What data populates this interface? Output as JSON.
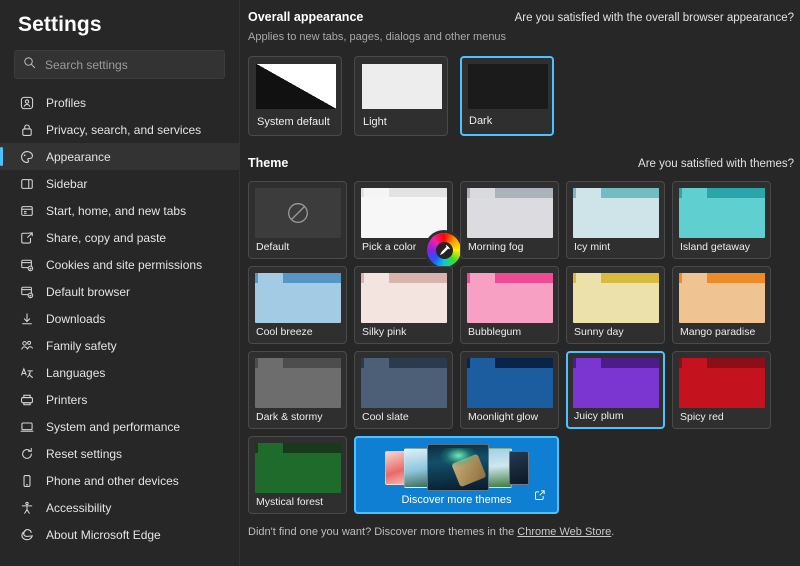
{
  "sidebar": {
    "title": "Settings",
    "search": {
      "placeholder": "Search settings",
      "value": "",
      "icon": "search-icon"
    },
    "items": [
      {
        "label": "Profiles",
        "icon": "profile-icon",
        "selected": false
      },
      {
        "label": "Privacy, search, and services",
        "icon": "lock-icon",
        "selected": false
      },
      {
        "label": "Appearance",
        "icon": "appearance-icon",
        "selected": true
      },
      {
        "label": "Sidebar",
        "icon": "sidebar-icon",
        "selected": false
      },
      {
        "label": "Start, home, and new tabs",
        "icon": "home-tabs-icon",
        "selected": false
      },
      {
        "label": "Share, copy and paste",
        "icon": "share-icon",
        "selected": false
      },
      {
        "label": "Cookies and site permissions",
        "icon": "cookies-icon",
        "selected": false
      },
      {
        "label": "Default browser",
        "icon": "default-browser-icon",
        "selected": false
      },
      {
        "label": "Downloads",
        "icon": "download-icon",
        "selected": false
      },
      {
        "label": "Family safety",
        "icon": "family-icon",
        "selected": false
      },
      {
        "label": "Languages",
        "icon": "languages-icon",
        "selected": false
      },
      {
        "label": "Printers",
        "icon": "printer-icon",
        "selected": false
      },
      {
        "label": "System and performance",
        "icon": "system-icon",
        "selected": false
      },
      {
        "label": "Reset settings",
        "icon": "reset-icon",
        "selected": false
      },
      {
        "label": "Phone and other devices",
        "icon": "phone-icon",
        "selected": false
      },
      {
        "label": "Accessibility",
        "icon": "accessibility-icon",
        "selected": false
      },
      {
        "label": "About Microsoft Edge",
        "icon": "edge-icon",
        "selected": false
      }
    ]
  },
  "overall_appearance": {
    "title": "Overall appearance",
    "feedback_link": "Are you satisfied with the overall browser appearance?",
    "subtitle": "Applies to new tabs, pages, dialogs and other menus",
    "options": [
      {
        "label": "System default",
        "selected": false
      },
      {
        "label": "Light",
        "selected": false
      },
      {
        "label": "Dark",
        "selected": true
      }
    ]
  },
  "theme": {
    "title": "Theme",
    "feedback_link": "Are you satisfied with themes?",
    "selected": "Juicy plum",
    "accent_color": "#4cc2ff",
    "cards": [
      {
        "label": "Default",
        "kind": "default",
        "top": "#3c3c3c",
        "tab": "#3c3c3c",
        "body": "#3c3c3c",
        "selected": false
      },
      {
        "label": "Pick a color",
        "kind": "picker",
        "top": "#e3e3e3",
        "tab": "#f5f5f5",
        "body": "#f7f7f7",
        "selected": false
      },
      {
        "label": "Morning fog",
        "kind": "folder",
        "top": "#adb3bb",
        "tab": "#d9dade",
        "body": "#dcdce0",
        "selected": false
      },
      {
        "label": "Icy mint",
        "kind": "folder",
        "top": "#74bcc4",
        "tab": "#cfe4e8",
        "body": "#cfe4e8",
        "selected": false
      },
      {
        "label": "Island getaway",
        "kind": "folder",
        "top": "#2aa5a9",
        "tab": "#5fd0cf",
        "body": "#5fd0cf",
        "selected": false
      },
      {
        "label": "Cool breeze",
        "kind": "folder",
        "top": "#5596c4",
        "tab": "#a3cbe4",
        "body": "#a3cbe4",
        "selected": false
      },
      {
        "label": "Silky pink",
        "kind": "folder",
        "top": "#d9b4ad",
        "tab": "#f3e4e0",
        "body": "#f3e4e0",
        "selected": false
      },
      {
        "label": "Bubblegum",
        "kind": "folder",
        "top": "#ef4b93",
        "tab": "#f8a0c4",
        "body": "#f8a0c4",
        "selected": false
      },
      {
        "label": "Sunny day",
        "kind": "folder",
        "top": "#d8bb3f",
        "tab": "#ece0ab",
        "body": "#ece0ab",
        "selected": false
      },
      {
        "label": "Mango paradise",
        "kind": "folder",
        "top": "#ef8a28",
        "tab": "#f0c392",
        "body": "#f0c392",
        "selected": false
      },
      {
        "label": "Dark & stormy",
        "kind": "folder",
        "top": "#4d4d4d",
        "tab": "#6d6d6d",
        "body": "#6d6d6d",
        "selected": false
      },
      {
        "label": "Cool slate",
        "kind": "folder",
        "top": "#2c3a4e",
        "tab": "#4d5e77",
        "body": "#4d5e77",
        "selected": false
      },
      {
        "label": "Moonlight glow",
        "kind": "folder",
        "top": "#0b2347",
        "tab": "#1b5d9e",
        "body": "#1b5d9e",
        "selected": false
      },
      {
        "label": "Juicy plum",
        "kind": "folder",
        "top": "#4b1d86",
        "tab": "#7b35d1",
        "body": "#7b35d1",
        "selected": true
      },
      {
        "label": "Spicy red",
        "kind": "folder",
        "top": "#8a0f17",
        "tab": "#c5121f",
        "body": "#c5121f",
        "selected": false
      },
      {
        "label": "Mystical forest",
        "kind": "folder",
        "top": "#18391c",
        "tab": "#1f6b2c",
        "body": "#1f6b2c",
        "selected": false
      }
    ],
    "discover": {
      "label": "Discover more themes",
      "icon": "external-link-icon"
    },
    "footnote_prefix": "Didn't find one you want? Discover more themes in the ",
    "footnote_link": "Chrome Web Store",
    "footnote_suffix": "."
  }
}
